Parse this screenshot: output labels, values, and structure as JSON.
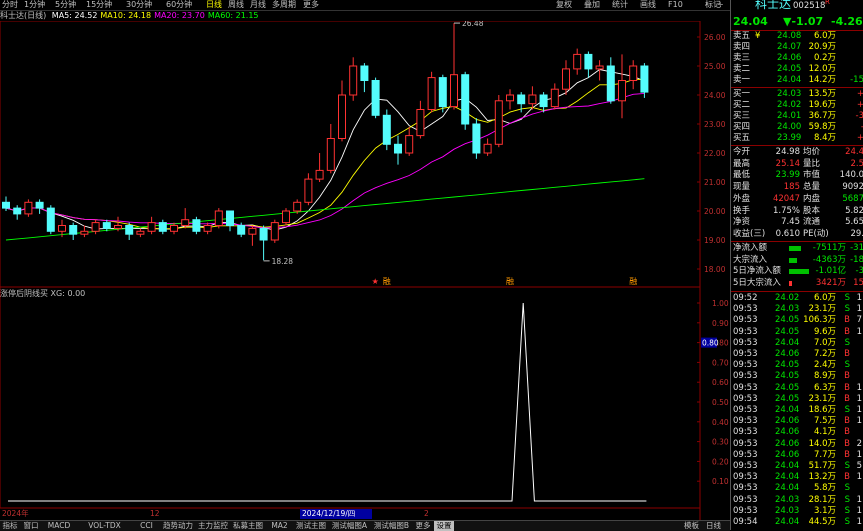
{
  "toolbar": {
    "periods": [
      "分时",
      "1分钟",
      "5分钟",
      "15分钟",
      "30分钟",
      "60分钟",
      "日线",
      "周线",
      "月线",
      "多周期",
      "更多"
    ],
    "active_period": "日线",
    "right_buttons": [
      "复权",
      "叠加",
      "统计",
      "画线",
      "F10",
      "标记"
    ],
    "window_controls": [
      "-",
      "÷"
    ]
  },
  "ma_legend": {
    "prefix": "科士达(日线)",
    "items": [
      {
        "label": "MA5: 24.52",
        "color": "#ffffff"
      },
      {
        "label": "MA10: 24.18",
        "color": "#ffff00"
      },
      {
        "label": "MA20: 23.70",
        "color": "#ff00ff"
      },
      {
        "label": "MA60: 21.15",
        "color": "#00ff00"
      }
    ]
  },
  "main_chart": {
    "y_ticks": [
      "26.00",
      "25.00",
      "24.00",
      "23.00",
      "22.00",
      "21.00",
      "20.00",
      "19.00",
      "18.00"
    ],
    "high_annotation": "26.48",
    "low_annotation": "18.28",
    "markers": [
      "★",
      "融",
      "融",
      "融"
    ],
    "x_start_label": "2024年",
    "x_label_2": "12",
    "x_cursor_label": "2024/12/19/四",
    "x_label_3": "2"
  },
  "candles": [
    [
      20.3,
      20.1,
      20.5,
      20.0
    ],
    [
      20.1,
      19.9,
      20.2,
      19.7
    ],
    [
      19.9,
      20.3,
      20.4,
      19.8
    ],
    [
      20.3,
      20.1,
      20.4,
      19.9
    ],
    [
      20.1,
      19.3,
      20.2,
      19.2
    ],
    [
      19.3,
      19.5,
      19.7,
      19.1
    ],
    [
      19.5,
      19.2,
      19.6,
      19.0
    ],
    [
      19.2,
      19.3,
      19.5,
      19.1
    ],
    [
      19.3,
      19.6,
      19.7,
      19.2
    ],
    [
      19.6,
      19.4,
      19.7,
      19.3
    ],
    [
      19.4,
      19.5,
      19.8,
      19.3
    ],
    [
      19.5,
      19.2,
      19.6,
      19.0
    ],
    [
      19.2,
      19.3,
      19.4,
      19.1
    ],
    [
      19.3,
      19.6,
      19.8,
      19.2
    ],
    [
      19.6,
      19.3,
      19.7,
      19.2
    ],
    [
      19.3,
      19.5,
      19.6,
      19.2
    ],
    [
      19.5,
      19.7,
      20.1,
      19.4
    ],
    [
      19.7,
      19.3,
      19.8,
      19.2
    ],
    [
      19.3,
      19.5,
      19.6,
      19.2
    ],
    [
      19.5,
      20.0,
      20.1,
      19.4
    ],
    [
      20.0,
      19.5,
      20.0,
      19.3
    ],
    [
      19.5,
      19.2,
      19.6,
      19.1
    ],
    [
      19.2,
      19.4,
      19.5,
      18.8
    ],
    [
      19.4,
      19.0,
      19.5,
      18.3
    ],
    [
      19.0,
      19.6,
      19.7,
      18.9
    ],
    [
      19.6,
      20.0,
      20.1,
      19.5
    ],
    [
      20.0,
      20.3,
      20.4,
      19.9
    ],
    [
      20.3,
      21.1,
      21.3,
      20.2
    ],
    [
      21.1,
      21.4,
      22.0,
      21.0
    ],
    [
      21.4,
      22.5,
      23.0,
      21.3
    ],
    [
      22.5,
      24.0,
      24.5,
      22.4
    ],
    [
      24.0,
      25.0,
      25.3,
      23.8
    ],
    [
      25.0,
      24.5,
      25.1,
      24.1
    ],
    [
      24.5,
      23.3,
      24.6,
      23.2
    ],
    [
      23.3,
      22.3,
      23.5,
      22.1
    ],
    [
      22.3,
      22.0,
      22.6,
      21.6
    ],
    [
      22.0,
      22.6,
      22.9,
      21.9
    ],
    [
      22.6,
      23.5,
      23.8,
      22.5
    ],
    [
      23.5,
      24.6,
      24.8,
      23.4
    ],
    [
      24.6,
      23.6,
      24.7,
      23.4
    ],
    [
      23.6,
      24.7,
      26.48,
      23.5
    ],
    [
      24.7,
      23.0,
      24.8,
      22.8
    ],
    [
      23.0,
      22.0,
      23.2,
      21.8
    ],
    [
      22.0,
      22.3,
      22.5,
      21.9
    ],
    [
      22.3,
      23.8,
      24.0,
      22.2
    ],
    [
      23.8,
      24.0,
      24.2,
      23.5
    ],
    [
      24.0,
      23.7,
      24.1,
      23.4
    ],
    [
      23.7,
      24.0,
      24.3,
      23.5
    ],
    [
      24.0,
      23.6,
      24.1,
      23.4
    ],
    [
      23.6,
      24.2,
      24.4,
      23.5
    ],
    [
      24.2,
      24.9,
      25.2,
      24.0
    ],
    [
      24.9,
      25.4,
      25.6,
      24.7
    ],
    [
      25.4,
      24.9,
      25.5,
      24.6
    ],
    [
      24.9,
      25.0,
      25.2,
      24.5
    ],
    [
      25.0,
      23.8,
      25.3,
      23.7
    ],
    [
      23.8,
      24.5,
      25.4,
      23.2
    ],
    [
      24.5,
      25.0,
      25.2,
      24.2
    ],
    [
      25.0,
      24.1,
      25.1,
      23.9
    ]
  ],
  "indicator": {
    "title": "涨停后阴线买 XG: 0.00",
    "y_ticks": [
      "1.00",
      "0.90",
      "0.80",
      "0.70",
      "0.60",
      "0.50",
      "0.40",
      "0.30",
      "0.20",
      "0.10"
    ],
    "current_value": "0.80",
    "values": [
      0,
      0,
      0,
      0,
      0,
      0,
      0,
      0,
      0,
      0,
      0,
      0,
      0,
      0,
      0,
      0,
      0,
      0,
      0,
      0,
      0,
      0,
      0,
      0,
      0,
      0,
      0,
      0,
      0,
      0,
      0,
      0,
      0,
      0,
      0,
      0,
      0,
      0,
      0,
      0,
      0,
      0,
      0,
      0,
      0,
      0,
      1,
      0,
      0,
      0,
      0,
      0,
      0,
      0,
      0,
      0,
      0,
      0
    ]
  },
  "tabs": [
    "指标",
    "窗口",
    "MACD",
    "VOL-TDX",
    "CCI",
    "趋势动力",
    "主力监控",
    "私募主图",
    "MA2",
    "测试主图",
    "测试幅图A",
    "测试幅图B",
    "更多",
    "设置"
  ],
  "tab_active": "设置",
  "tab_right": [
    "模板",
    "日线"
  ],
  "quote": {
    "name": "科士达",
    "code": "002518",
    "flag": "R",
    "price": "24.04",
    "change": "▼-1.07",
    "pct": "-4.26%",
    "asks": [
      {
        "label": "卖五",
        "mark": "¥",
        "price": "24.08",
        "vol": "6.0万"
      },
      {
        "label": "卖四",
        "mark": "",
        "price": "24.07",
        "vol": "20.9万"
      },
      {
        "label": "卖三",
        "mark": "",
        "price": "24.06",
        "vol": "0.2万"
      },
      {
        "label": "卖二",
        "mark": "",
        "price": "24.05",
        "vol": "12.0万"
      },
      {
        "label": "卖一",
        "mark": "",
        "price": "24.04",
        "vol": "14.2万",
        "extra": "-15"
      }
    ],
    "bids": [
      {
        "label": "买一",
        "price": "24.03",
        "vol": "13.5万",
        "extra": "+"
      },
      {
        "label": "买二",
        "price": "24.02",
        "vol": "19.6万",
        "extra": "+"
      },
      {
        "label": "买三",
        "price": "24.01",
        "vol": "36.7万",
        "extra": "-3"
      },
      {
        "label": "买四",
        "price": "24.00",
        "vol": "59.8万",
        "extra": "-"
      },
      {
        "label": "买五",
        "price": "23.99",
        "vol": "8.4万",
        "extra": "+"
      }
    ],
    "stats": [
      {
        "k1": "今开",
        "v1": "24.98",
        "k2": "均价",
        "v2": "24.4"
      },
      {
        "k1": "最高",
        "v1": "25.14",
        "k2": "量比",
        "v2": "2.5"
      },
      {
        "k1": "最低",
        "v1": "23.99",
        "k2": "市值",
        "v2": "140.0"
      },
      {
        "k1": "现量",
        "v1": "185",
        "k2": "总量",
        "v2": "9092"
      },
      {
        "k1": "外盘",
        "v1": "42047",
        "k2": "内盘",
        "v2": "5687"
      },
      {
        "k1": "换手",
        "v1": "1.75%",
        "k2": "股本",
        "v2": "5.82"
      },
      {
        "k1": "净资",
        "v1": "7.45",
        "k2": "流通",
        "v2": "5.65"
      },
      {
        "k1": "收益(三)",
        "v1": "0.610",
        "k2": "PE(动)",
        "v2": "29."
      }
    ],
    "flows": [
      {
        "label": "净流入额",
        "value": "-7511万",
        "extra": "-31",
        "bar": 0.3
      },
      {
        "label": "大宗流入",
        "value": "-4363万",
        "extra": "-18",
        "bar": 0.2
      },
      {
        "label": "5日净流入额",
        "value": "-1.01亿",
        "extra": "-3",
        "bar": 0.5
      },
      {
        "label": "5日大宗流入",
        "value": "3421万",
        "extra": "15",
        "bar": 0.08
      }
    ],
    "ticks": [
      {
        "t": "09:52",
        "p": "24.02",
        "v": "6.0万",
        "s": "S",
        "n": "1"
      },
      {
        "t": "09:53",
        "p": "24.03",
        "v": "23.1万",
        "s": "S",
        "n": "1"
      },
      {
        "t": "09:53",
        "p": "24.05",
        "v": "106.3万",
        "s": "B",
        "n": "7"
      },
      {
        "t": "09:53",
        "p": "24.05",
        "v": "9.6万",
        "s": "B",
        "n": "1"
      },
      {
        "t": "09:53",
        "p": "24.04",
        "v": "7.0万",
        "s": "S",
        "n": ""
      },
      {
        "t": "09:53",
        "p": "24.06",
        "v": "7.2万",
        "s": "B",
        "n": ""
      },
      {
        "t": "09:53",
        "p": "24.05",
        "v": "2.4万",
        "s": "S",
        "n": ""
      },
      {
        "t": "09:53",
        "p": "24.05",
        "v": "8.9万",
        "s": "B",
        "n": ""
      },
      {
        "t": "09:53",
        "p": "24.05",
        "v": "6.3万",
        "s": "B",
        "n": "1"
      },
      {
        "t": "09:53",
        "p": "24.05",
        "v": "23.1万",
        "s": "B",
        "n": "1"
      },
      {
        "t": "09:53",
        "p": "24.04",
        "v": "18.6万",
        "s": "S",
        "n": "1"
      },
      {
        "t": "09:53",
        "p": "24.06",
        "v": "7.5万",
        "s": "B",
        "n": "1"
      },
      {
        "t": "09:53",
        "p": "24.06",
        "v": "4.1万",
        "s": "B",
        "n": ""
      },
      {
        "t": "09:53",
        "p": "24.06",
        "v": "14.0万",
        "s": "B",
        "n": "2"
      },
      {
        "t": "09:53",
        "p": "24.06",
        "v": "7.7万",
        "s": "B",
        "n": "1"
      },
      {
        "t": "09:53",
        "p": "24.04",
        "v": "51.7万",
        "s": "S",
        "n": "5"
      },
      {
        "t": "09:53",
        "p": "24.04",
        "v": "13.2万",
        "s": "B",
        "n": "1"
      },
      {
        "t": "09:53",
        "p": "24.04",
        "v": "5.8万",
        "s": "S",
        "n": ""
      },
      {
        "t": "09:53",
        "p": "24.03",
        "v": "28.1万",
        "s": "S",
        "n": "1"
      },
      {
        "t": "09:53",
        "p": "24.03",
        "v": "3.1万",
        "s": "S",
        "n": "1"
      },
      {
        "t": "09:54",
        "p": "24.04",
        "v": "44.5万",
        "s": "S",
        "n": "1"
      }
    ]
  },
  "colors": {
    "up": "#ff3232",
    "down": "#54fcfc",
    "ma5": "#ffffff",
    "ma10": "#ffff00",
    "ma20": "#ff00ff",
    "ma60": "#00ff00",
    "axis": "#8b0000"
  }
}
